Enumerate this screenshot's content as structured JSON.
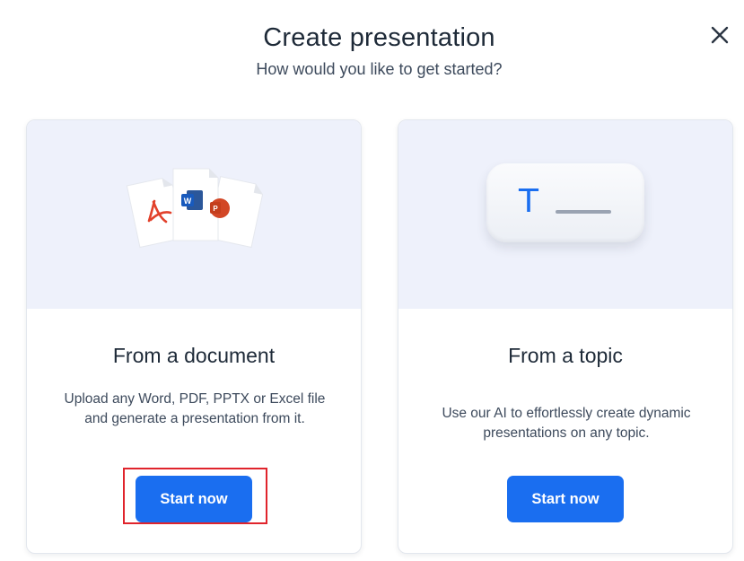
{
  "dialog": {
    "title": "Create presentation",
    "subtitle": "How would you like to get started?",
    "close_icon": "close-icon"
  },
  "cards": [
    {
      "title": "From a document",
      "description": "Upload any Word, PDF, PPTX or Excel file and generate a presentation from it.",
      "button_label": "Start now",
      "illustration_icons": [
        "pdf-icon",
        "word-icon",
        "powerpoint-icon"
      ],
      "highlighted": true
    },
    {
      "title": "From a topic",
      "description": "Use our AI to effortlessly create dynamic presentations on any topic.",
      "button_label": "Start now",
      "illustration_text": "T"
    }
  ],
  "colors": {
    "accent": "#1a6ef0",
    "hero_background": "#eef1fb",
    "highlight": "#e0242c",
    "pdf_red": "#e2412b",
    "word_blue": "#2b579a",
    "powerpoint_orange": "#d24726"
  }
}
